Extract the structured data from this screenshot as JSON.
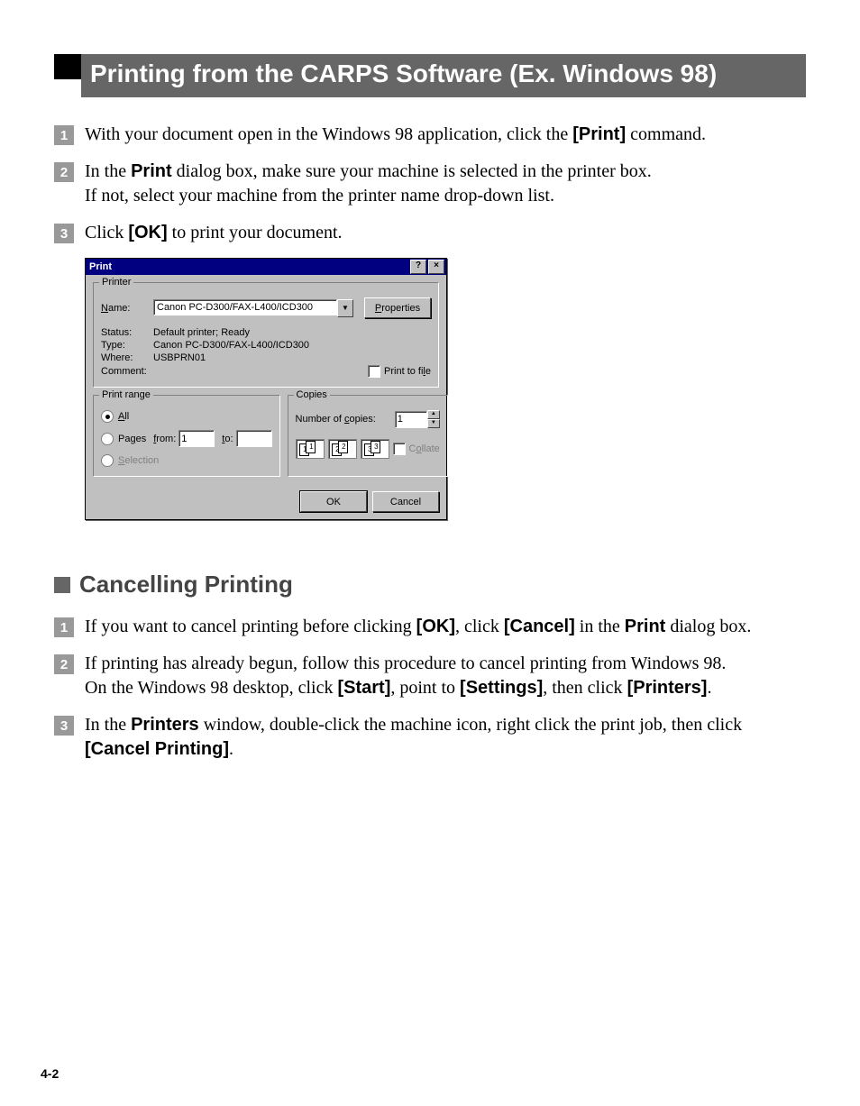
{
  "heading": "Printing from the CARPS Software (Ex. Windows 98)",
  "steps_a": {
    "s1": {
      "pre": "With your document open in the Windows 98 application, click the ",
      "b1": "[Print]",
      "post": " command."
    },
    "s2": {
      "pre": "In the ",
      "b1": "Print",
      "mid": " dialog box, make sure your machine is selected in the printer box.",
      "line2": "If not, select your machine from the printer name drop-down list."
    },
    "s3": {
      "pre": "Click ",
      "b1": "[OK]",
      "post": " to print your document."
    }
  },
  "dialog": {
    "title": "Print",
    "printer": {
      "legend": "Printer",
      "name_lbl": "Name:",
      "name_u": "N",
      "name_val": "Canon PC-D300/FAX-L400/ICD300",
      "prop_btn": "Properties",
      "prop_u": "P",
      "status_lbl": "Status:",
      "status_val": "Default printer; Ready",
      "type_lbl": "Type:",
      "type_val": "Canon PC-D300/FAX-L400/ICD300",
      "where_lbl": "Where:",
      "where_val": "USBPRN01",
      "comment_lbl": "Comment:",
      "ptf": "Print to file",
      "ptf_u": "l"
    },
    "range": {
      "legend": "Print range",
      "all": "All",
      "all_u": "A",
      "pages": "Pages",
      "pages_u": "g",
      "from": "from:",
      "from_u": "f",
      "from_val": "1",
      "to": "to:",
      "to_u": "t",
      "sel": "Selection",
      "sel_u": "S"
    },
    "copies": {
      "legend": "Copies",
      "num_lbl": "Number of copies:",
      "num_u": "c",
      "num_val": "1",
      "collate": "Collate",
      "collate_u": "o",
      "g1a": "1",
      "g1b": "1",
      "g2a": "2",
      "g2b": "2",
      "g3a": "3",
      "g3b": "3"
    },
    "ok": "OK",
    "cancel": "Cancel"
  },
  "subhead": "Cancelling Printing",
  "steps_b": {
    "s1": {
      "pre": "If you want to cancel printing before clicking ",
      "b1": "[OK]",
      "mid": ", click ",
      "b2": "[Cancel]",
      "mid2": " in the ",
      "b3": "Print",
      "post": " dialog box."
    },
    "s2": {
      "line1": "If printing has already begun, follow this procedure to cancel printing from Windows 98.",
      "pre": "On the Windows 98 desktop, click ",
      "b1": "[Start]",
      "mid": ", point to ",
      "b2": "[Settings]",
      "mid2": ", then click ",
      "b3": "[Printers]",
      "post": "."
    },
    "s3": {
      "pre": "In the ",
      "b1": "Printers",
      "mid": " window, double-click the machine icon, right click the print job, then click ",
      "b2": "[Cancel Printing]",
      "post": "."
    }
  },
  "pagenum": "4-2",
  "nums": {
    "n1": "1",
    "n2": "2",
    "n3": "3"
  }
}
